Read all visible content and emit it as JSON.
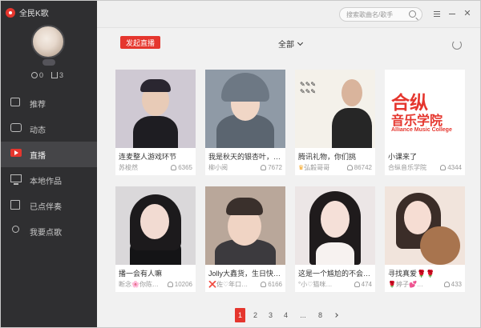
{
  "app": {
    "title": "全民K歌"
  },
  "user": {
    "stat_1": "0",
    "stat_2": "3"
  },
  "sidebar": {
    "items": [
      {
        "label": "推荐"
      },
      {
        "label": "动态"
      },
      {
        "label": "直播"
      },
      {
        "label": "本地作品"
      },
      {
        "label": "已点伴奏"
      },
      {
        "label": "我要点歌"
      }
    ]
  },
  "header": {
    "search_placeholder": "搜索歌曲名/歌手"
  },
  "toolbar": {
    "live_button": "发起直播",
    "filter_label": "全部"
  },
  "cards": [
    {
      "title": "连麦整人游戏环节",
      "host": "苏梭然",
      "viewers": "6365"
    },
    {
      "title": "我是秋天的银杏叶，…",
      "host": "柳小阅",
      "viewers": "7672"
    },
    {
      "title": "腾讯礼物，你们挑",
      "host": "弘毅哥哥",
      "viewers": "86742"
    },
    {
      "title": "小课来了",
      "host": "合纵音乐学院",
      "viewers": "4344"
    },
    {
      "title": "播一会有人嘛",
      "host": "断念🌸你陈…",
      "viewers": "10206"
    },
    {
      "title": "Jolly大鑫货，生日快…",
      "host": "❌佐♡年口…",
      "viewers": "6166"
    },
    {
      "title": "这是一个尴尬的不会…",
      "host": "°小♡猫咪…",
      "viewers": "474"
    },
    {
      "title": "寻找真爱🌹🌹",
      "host": "🌹婷子💕…",
      "viewers": "433"
    }
  ],
  "logo_text": {
    "line1": "合纵",
    "line2": "音乐学院",
    "line3": "Alliance Music College"
  },
  "pagination": {
    "p1": "1",
    "p2": "2",
    "p3": "3",
    "p4": "4",
    "dots": "...",
    "p8": "8"
  },
  "colors": {
    "accent": "#e5362e",
    "sidebar_bg": "#2f2f31",
    "sidebar_active": "#454548"
  }
}
